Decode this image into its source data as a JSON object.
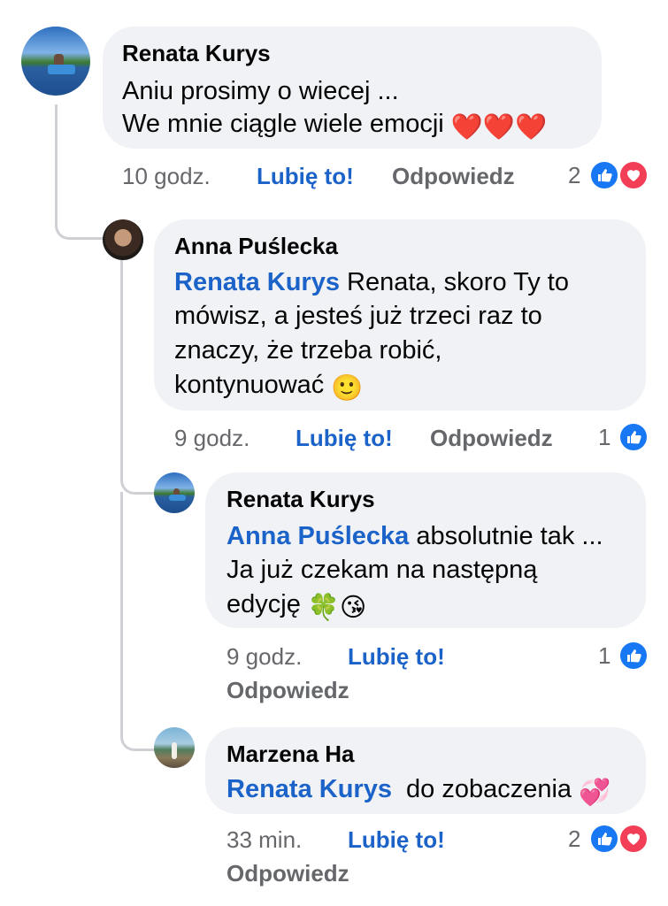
{
  "comments": [
    {
      "author": "Renata Kurys",
      "line1": "Aniu prosimy o wiecej ...",
      "line2": "We mnie ciągle wiele emocji",
      "emoji": "❤️❤️❤️",
      "time": "10 godz.",
      "like_label": "Lubię to!",
      "reply_label": "Odpowiedz",
      "reaction_count": "2",
      "reactions": [
        "like-icon",
        "love-icon"
      ]
    },
    {
      "author": "Anna Puślecka",
      "mention": "Renata Kurys",
      "line1": "Renata, skoro Ty to",
      "line2": "mówisz, a jesteś już trzeci raz to",
      "line3": "znaczy, że trzeba robić,",
      "line4": "kontynuować",
      "emoji": "🙂",
      "time": "9 godz.",
      "like_label": "Lubię to!",
      "reply_label": "Odpowiedz",
      "reaction_count": "1",
      "reactions": [
        "like-icon"
      ]
    },
    {
      "author": "Renata Kurys",
      "mention": "Anna Puślecka",
      "line1": "absolutnie tak ...",
      "line2": "Ja już czekam na następną",
      "line3": "edycję",
      "emoji": "🍀😘",
      "time": "9 godz.",
      "like_label": "Lubię to!",
      "reply_label": "Odpowiedz",
      "reaction_count": "1",
      "reactions": [
        "like-icon"
      ]
    },
    {
      "author": "Marzena Ha",
      "mention": "Renata Kurys",
      "line1": "do zobaczenia",
      "emoji": "💞",
      "time": "33 min.",
      "like_label": "Lubię to!",
      "reply_label": "Odpowiedz",
      "reaction_count": "2",
      "reactions": [
        "like-icon",
        "love-icon"
      ]
    }
  ],
  "colors": {
    "mention": "#1b63c9",
    "bubble": "#f0f2f5",
    "meta": "#65676b",
    "like_reaction": "#1877f2",
    "love_reaction": "#f33e58"
  }
}
